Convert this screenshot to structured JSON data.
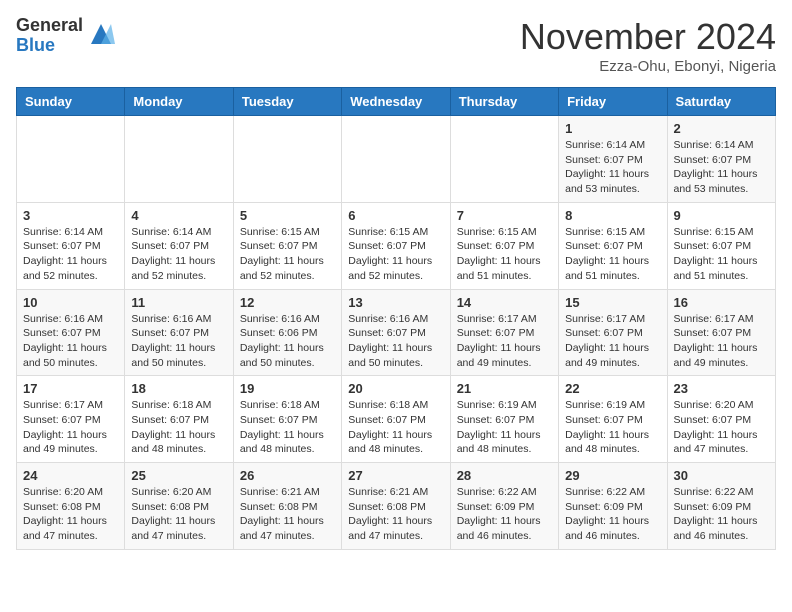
{
  "header": {
    "logo_general": "General",
    "logo_blue": "Blue",
    "month_title": "November 2024",
    "location": "Ezza-Ohu, Ebonyi, Nigeria"
  },
  "days_of_week": [
    "Sunday",
    "Monday",
    "Tuesday",
    "Wednesday",
    "Thursday",
    "Friday",
    "Saturday"
  ],
  "weeks": [
    [
      {
        "day": "",
        "info": ""
      },
      {
        "day": "",
        "info": ""
      },
      {
        "day": "",
        "info": ""
      },
      {
        "day": "",
        "info": ""
      },
      {
        "day": "",
        "info": ""
      },
      {
        "day": "1",
        "info": "Sunrise: 6:14 AM\nSunset: 6:07 PM\nDaylight: 11 hours\nand 53 minutes."
      },
      {
        "day": "2",
        "info": "Sunrise: 6:14 AM\nSunset: 6:07 PM\nDaylight: 11 hours\nand 53 minutes."
      }
    ],
    [
      {
        "day": "3",
        "info": "Sunrise: 6:14 AM\nSunset: 6:07 PM\nDaylight: 11 hours\nand 52 minutes."
      },
      {
        "day": "4",
        "info": "Sunrise: 6:14 AM\nSunset: 6:07 PM\nDaylight: 11 hours\nand 52 minutes."
      },
      {
        "day": "5",
        "info": "Sunrise: 6:15 AM\nSunset: 6:07 PM\nDaylight: 11 hours\nand 52 minutes."
      },
      {
        "day": "6",
        "info": "Sunrise: 6:15 AM\nSunset: 6:07 PM\nDaylight: 11 hours\nand 52 minutes."
      },
      {
        "day": "7",
        "info": "Sunrise: 6:15 AM\nSunset: 6:07 PM\nDaylight: 11 hours\nand 51 minutes."
      },
      {
        "day": "8",
        "info": "Sunrise: 6:15 AM\nSunset: 6:07 PM\nDaylight: 11 hours\nand 51 minutes."
      },
      {
        "day": "9",
        "info": "Sunrise: 6:15 AM\nSunset: 6:07 PM\nDaylight: 11 hours\nand 51 minutes."
      }
    ],
    [
      {
        "day": "10",
        "info": "Sunrise: 6:16 AM\nSunset: 6:07 PM\nDaylight: 11 hours\nand 50 minutes."
      },
      {
        "day": "11",
        "info": "Sunrise: 6:16 AM\nSunset: 6:07 PM\nDaylight: 11 hours\nand 50 minutes."
      },
      {
        "day": "12",
        "info": "Sunrise: 6:16 AM\nSunset: 6:06 PM\nDaylight: 11 hours\nand 50 minutes."
      },
      {
        "day": "13",
        "info": "Sunrise: 6:16 AM\nSunset: 6:07 PM\nDaylight: 11 hours\nand 50 minutes."
      },
      {
        "day": "14",
        "info": "Sunrise: 6:17 AM\nSunset: 6:07 PM\nDaylight: 11 hours\nand 49 minutes."
      },
      {
        "day": "15",
        "info": "Sunrise: 6:17 AM\nSunset: 6:07 PM\nDaylight: 11 hours\nand 49 minutes."
      },
      {
        "day": "16",
        "info": "Sunrise: 6:17 AM\nSunset: 6:07 PM\nDaylight: 11 hours\nand 49 minutes."
      }
    ],
    [
      {
        "day": "17",
        "info": "Sunrise: 6:17 AM\nSunset: 6:07 PM\nDaylight: 11 hours\nand 49 minutes."
      },
      {
        "day": "18",
        "info": "Sunrise: 6:18 AM\nSunset: 6:07 PM\nDaylight: 11 hours\nand 48 minutes."
      },
      {
        "day": "19",
        "info": "Sunrise: 6:18 AM\nSunset: 6:07 PM\nDaylight: 11 hours\nand 48 minutes."
      },
      {
        "day": "20",
        "info": "Sunrise: 6:18 AM\nSunset: 6:07 PM\nDaylight: 11 hours\nand 48 minutes."
      },
      {
        "day": "21",
        "info": "Sunrise: 6:19 AM\nSunset: 6:07 PM\nDaylight: 11 hours\nand 48 minutes."
      },
      {
        "day": "22",
        "info": "Sunrise: 6:19 AM\nSunset: 6:07 PM\nDaylight: 11 hours\nand 48 minutes."
      },
      {
        "day": "23",
        "info": "Sunrise: 6:20 AM\nSunset: 6:07 PM\nDaylight: 11 hours\nand 47 minutes."
      }
    ],
    [
      {
        "day": "24",
        "info": "Sunrise: 6:20 AM\nSunset: 6:08 PM\nDaylight: 11 hours\nand 47 minutes."
      },
      {
        "day": "25",
        "info": "Sunrise: 6:20 AM\nSunset: 6:08 PM\nDaylight: 11 hours\nand 47 minutes."
      },
      {
        "day": "26",
        "info": "Sunrise: 6:21 AM\nSunset: 6:08 PM\nDaylight: 11 hours\nand 47 minutes."
      },
      {
        "day": "27",
        "info": "Sunrise: 6:21 AM\nSunset: 6:08 PM\nDaylight: 11 hours\nand 47 minutes."
      },
      {
        "day": "28",
        "info": "Sunrise: 6:22 AM\nSunset: 6:09 PM\nDaylight: 11 hours\nand 46 minutes."
      },
      {
        "day": "29",
        "info": "Sunrise: 6:22 AM\nSunset: 6:09 PM\nDaylight: 11 hours\nand 46 minutes."
      },
      {
        "day": "30",
        "info": "Sunrise: 6:22 AM\nSunset: 6:09 PM\nDaylight: 11 hours\nand 46 minutes."
      }
    ]
  ]
}
